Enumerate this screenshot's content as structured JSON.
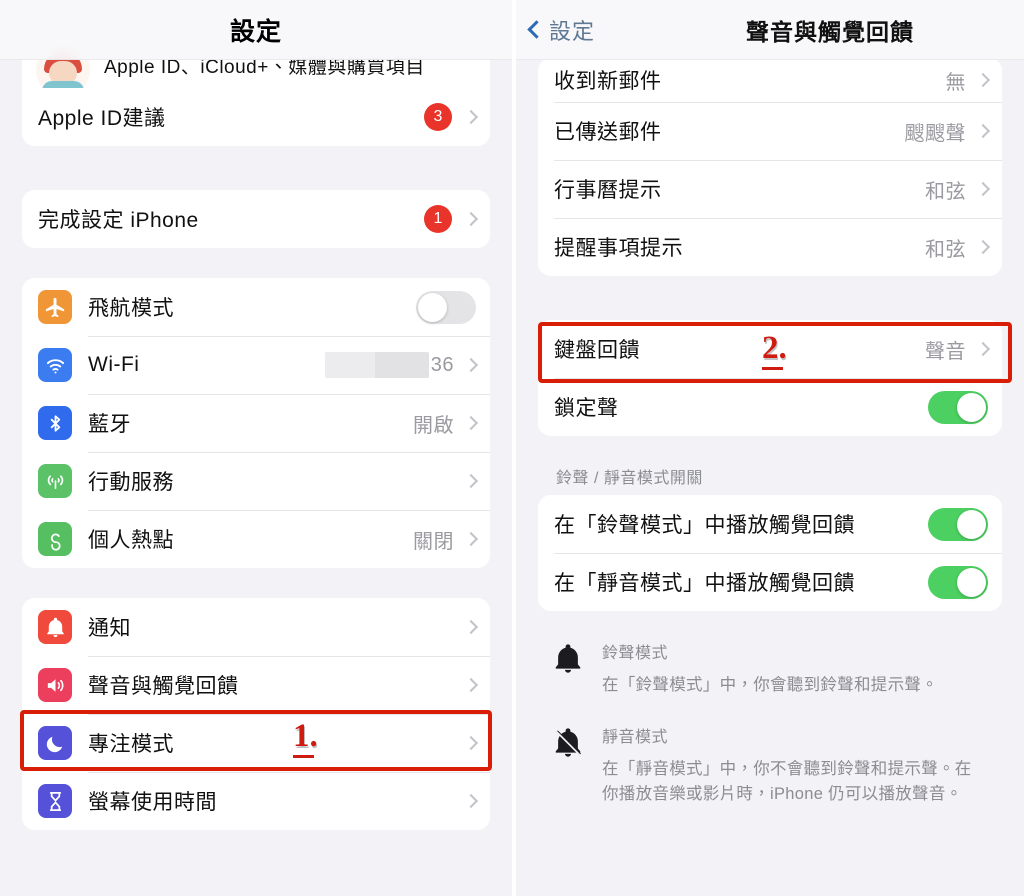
{
  "left_screen": {
    "navbar": {
      "title": "設定"
    },
    "profile": {
      "subtitle": "Apple ID、iCloud+、媒體與購買項目",
      "avatar_name": "user-avatar"
    },
    "group_apple_id": [
      {
        "label": "Apple ID建議",
        "badge": "3",
        "chevron": true
      }
    ],
    "group_setup": [
      {
        "label": "完成設定 iPhone",
        "badge": "1",
        "chevron": true
      }
    ],
    "group_connectivity": [
      {
        "label": "飛航模式",
        "icon": "airplane-icon",
        "icon_color": "#f09637",
        "control": "toggle",
        "toggle_on": false
      },
      {
        "label": "Wi-Fi",
        "icon": "wifi-icon",
        "icon_color": "#3b7df0",
        "value": "36",
        "value_redacted": true,
        "chevron": true
      },
      {
        "label": "藍牙",
        "icon": "bluetooth-icon",
        "icon_color": "#2f6bec",
        "value": "開啟",
        "chevron": true
      },
      {
        "label": "行動服務",
        "icon": "cellular-icon",
        "icon_color": "#5bc267",
        "value": "",
        "chevron": true
      },
      {
        "label": "個人熱點",
        "icon": "hotspot-icon",
        "icon_color": "#56bf62",
        "value": "關閉",
        "chevron": true
      }
    ],
    "group_system": [
      {
        "label": "通知",
        "icon": "bell-icon",
        "icon_color": "#ef4a3c",
        "chevron": true
      },
      {
        "label": "聲音與觸覺回饋",
        "icon": "speaker-icon",
        "icon_color": "#ec3f5e",
        "chevron": true,
        "highlighted": true
      },
      {
        "label": "專注模式",
        "icon": "moon-icon",
        "icon_color": "#5551d8",
        "chevron": true
      },
      {
        "label": "螢幕使用時間",
        "icon": "hourglass-icon",
        "icon_color": "#5551d8",
        "chevron": true
      }
    ],
    "annotation": {
      "step": "1."
    }
  },
  "right_screen": {
    "navbar": {
      "back_label": "設定",
      "title": "聲音與觸覺回饋"
    },
    "group_sounds": [
      {
        "label": "收到新郵件",
        "value": "無",
        "chevron": true
      },
      {
        "label": "已傳送郵件",
        "value": "颼颼聲",
        "chevron": true
      },
      {
        "label": "行事曆提示",
        "value": "和弦",
        "chevron": true
      },
      {
        "label": "提醒事項提示",
        "value": "和弦",
        "chevron": true
      }
    ],
    "group_keyboard": [
      {
        "label": "鍵盤回饋",
        "value": "聲音",
        "chevron": true,
        "highlighted": true
      },
      {
        "label": "鎖定聲",
        "control": "toggle",
        "toggle_on": true
      }
    ],
    "ringer_section": {
      "header": "鈴聲 / 靜音模式開關",
      "rows": [
        {
          "label": "在「鈴聲模式」中播放觸覺回饋",
          "control": "toggle",
          "toggle_on": true
        },
        {
          "label": "在「靜音模式」中播放觸覺回饋",
          "control": "toggle",
          "toggle_on": true
        }
      ]
    },
    "footers": [
      {
        "icon": "bell-filled-icon",
        "title": "鈴聲模式",
        "desc": "在「鈴聲模式」中，你會聽到鈴聲和提示聲。"
      },
      {
        "icon": "bell-slash-icon",
        "title": "靜音模式",
        "desc": "在「靜音模式」中，你不會聽到鈴聲和提示聲。在你播放音樂或影片時，iPhone 仍可以播放聲音。"
      }
    ],
    "annotation": {
      "step": "2."
    }
  },
  "theme": {
    "background": "#f2f2f7",
    "card": "#ffffff",
    "accent_red": "#d81e06",
    "badge_red": "#e8342a",
    "toggle_on": "#4cd061",
    "toggle_off": "#e4e4e7",
    "secondary_text": "#8c8c93"
  }
}
